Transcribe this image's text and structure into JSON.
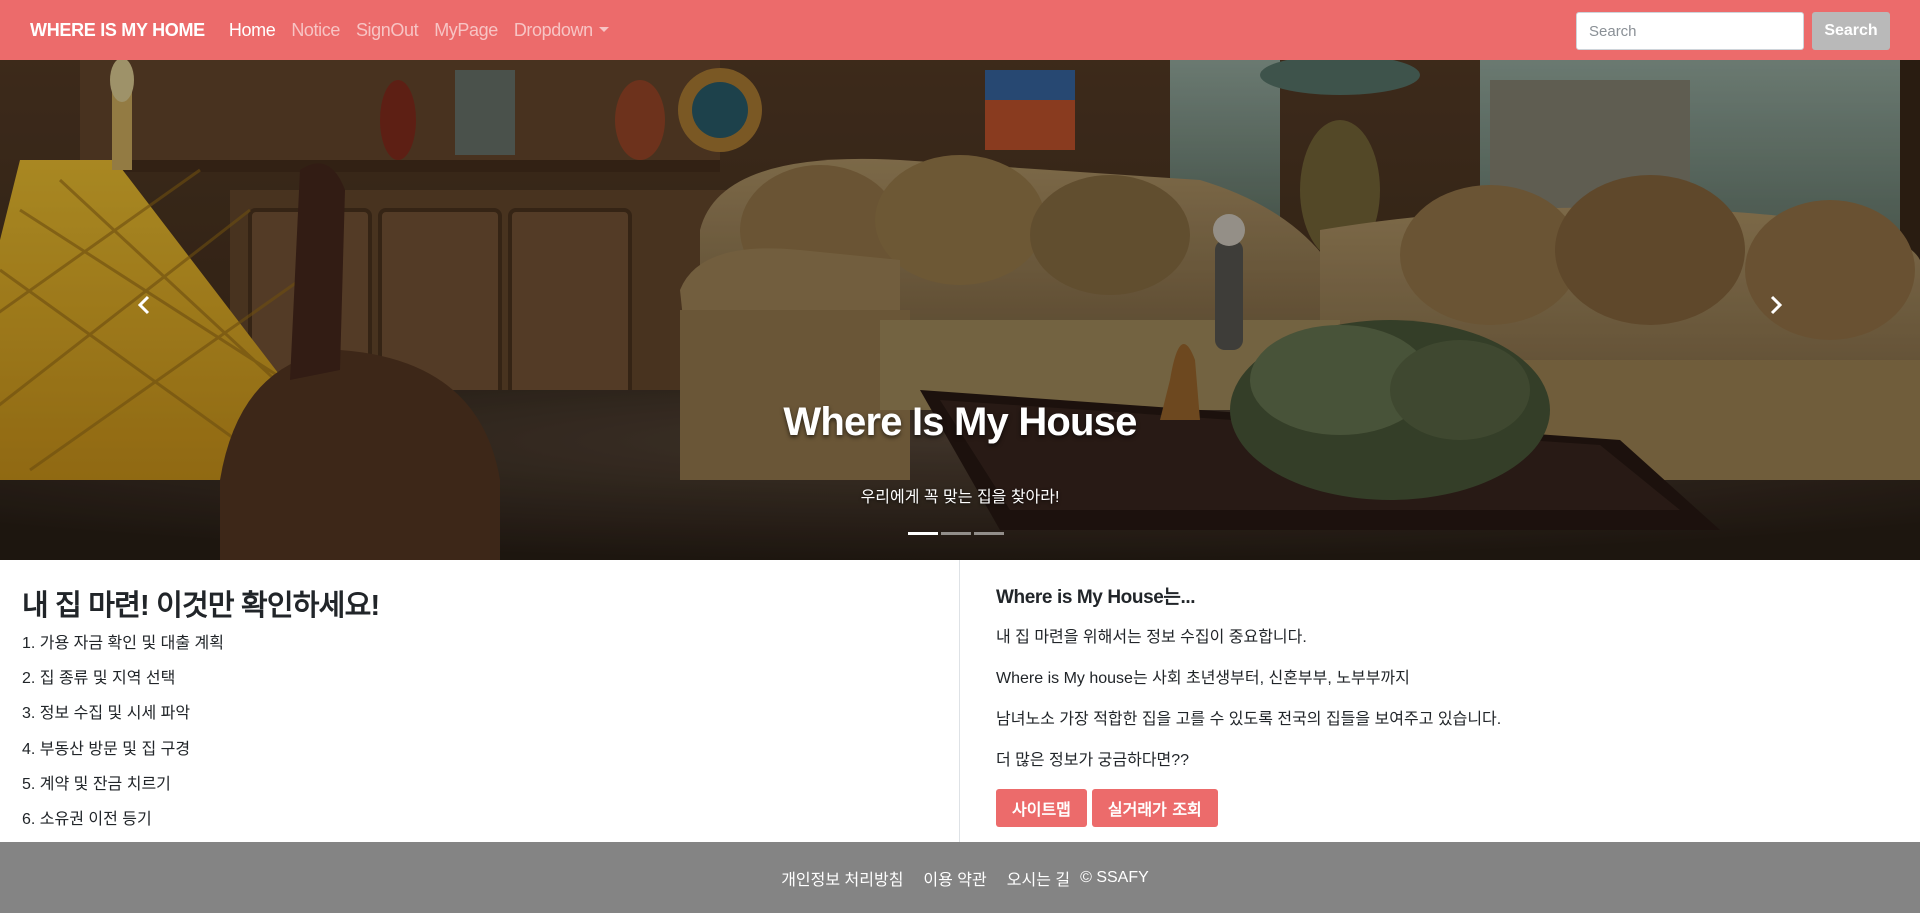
{
  "navbar": {
    "brand": "WHERE IS MY HOME",
    "links": [
      {
        "label": "Home",
        "active": true
      },
      {
        "label": "Notice"
      },
      {
        "label": "SignOut"
      },
      {
        "label": "MyPage"
      },
      {
        "label": "Dropdown"
      }
    ],
    "search": {
      "placeholder": "Search",
      "button_label": "Search"
    }
  },
  "carousel": {
    "title": "Where Is My House",
    "subtitle": "우리에게 꼭 맞는 집을 찾아라!",
    "slide_count": 3,
    "active_slide": 1
  },
  "left": {
    "heading": "내 집 마련! 이것만 확인하세요!",
    "steps": [
      "1. 가용 자금 확인 및 대출 계획",
      "2. 집 종류 및 지역 선택",
      "3. 정보 수집 및 시세 파악",
      "4. 부동산 방문 및 집 구경",
      "5. 계약 및 잔금 치르기",
      "6. 소유권 이전 등기"
    ]
  },
  "right": {
    "heading": "Where is My House는...",
    "paragraphs": [
      "내 집 마련을 위해서는 정보 수집이 중요합니다.",
      "Where is My house는 사회 초년생부터, 신혼부부, 노부부까지",
      "남녀노소 가장 적합한 집을 고를 수 있도록 전국의 집들을 보여주고 있습니다.",
      "더 많은 정보가 궁금하다면??"
    ],
    "buttons": [
      "사이트맵",
      "실거래가 조회"
    ]
  },
  "footer": {
    "links": [
      "개인정보 처리방침",
      "이용 약관",
      "오시는 길"
    ],
    "copyright": "© SSAFY"
  },
  "colors": {
    "primary": "#ec6b6b",
    "footer": "#848484",
    "search_button": "#b9b9b9"
  }
}
